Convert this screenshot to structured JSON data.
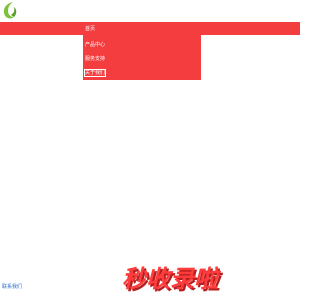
{
  "logo": {
    "icon": "leaf-logo-icon",
    "colors": {
      "leaf": "#7cc33b",
      "dark": "#5aa02a"
    }
  },
  "header": {
    "bar_color": "#f33d3f"
  },
  "nav": {
    "items": [
      {
        "label": "首页"
      },
      {
        "label": "产品中心"
      },
      {
        "label": "服务支持"
      },
      {
        "label": "关于我们"
      }
    ],
    "text_color": "#ffffff"
  },
  "footer": {
    "link_label": "联系我们",
    "link_color": "#2a6ccf"
  },
  "watermark": {
    "text": "秒收录啦",
    "color_fill": "#ff3b3b",
    "color_shadow": "#b51f1f"
  }
}
